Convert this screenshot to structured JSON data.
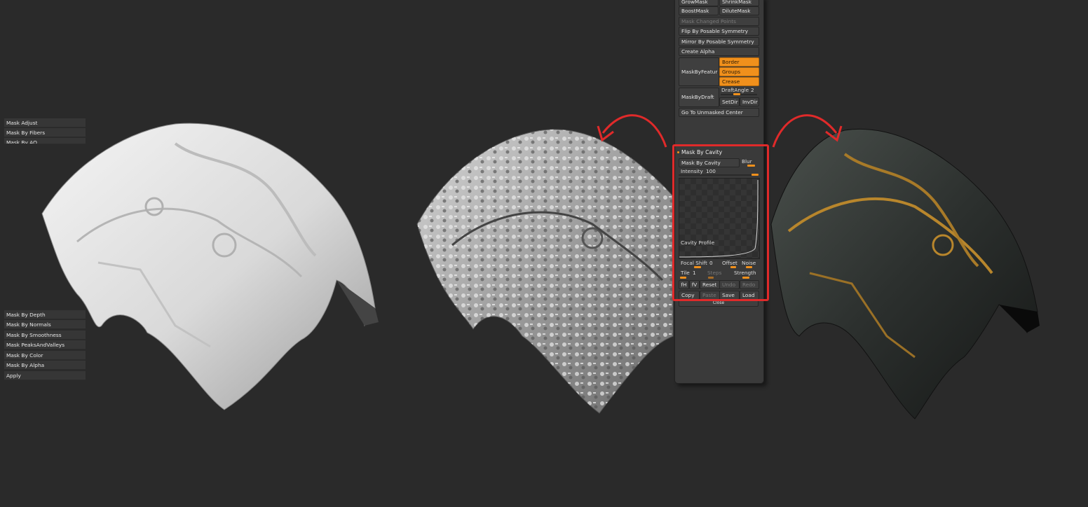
{
  "panel": {
    "buttons_top": {
      "growmask": "GrowMask",
      "shrinkmask": "ShrinkMask",
      "boostmask": "BoostMask",
      "dilutemask": "DiluteMask",
      "mask_changed_points": "Mask Changed Points",
      "flip_posable": "Flip By Posable Symmetry",
      "mirror_posable": "Mirror By Posable Symmetry",
      "create_alpha": "Create Alpha",
      "mask_by_features": "MaskByFeatur",
      "border": "Border",
      "groups": "Groups",
      "crease": "Crease",
      "mask_by_draft": "MaskByDraft",
      "draft_angle": "DraftAngle",
      "draft_angle_value": "2",
      "setdir": "SetDir",
      "invdir": "InvDir",
      "go_to_unmasked": "Go To Unmasked Center"
    },
    "subpalettes_top": {
      "mask_adjust": "Mask Adjust",
      "mask_by_fibers": "Mask By Fibers",
      "mask_by_ao": "Mask By AO"
    },
    "cavity": {
      "header": "Mask By Cavity",
      "button": "Mask By Cavity",
      "blur": "Blur",
      "intensity_label": "Intensity",
      "intensity_value": "100",
      "profile_label": "Cavity Profile",
      "focal_shift_label": "Focal Shift",
      "focal_shift_value": "0",
      "offset": "Offset",
      "noise": "Noise",
      "tile_label": "Tile",
      "tile_value": "1",
      "steps": "Steps",
      "strength": "Strength",
      "fh": "fH",
      "fv": "fV",
      "reset": "Reset",
      "undo": "Undo",
      "redo": "Redo",
      "copy": "Copy",
      "paste": "Paste",
      "save": "Save",
      "load": "Load",
      "close": "Close"
    },
    "subpalettes_bottom": {
      "mask_by_depth": "Mask By Depth",
      "mask_by_normals": "Mask By Normals",
      "mask_by_smoothness": "Mask By Smoothness",
      "mask_peaks": "Mask PeaksAndValleys",
      "mask_by_color": "Mask By Color",
      "mask_by_alpha": "Mask By Alpha",
      "apply": "Apply"
    }
  },
  "colors": {
    "background": "#2a2a2a",
    "accent": "#f0901c",
    "highlight": "#e02a2a"
  }
}
